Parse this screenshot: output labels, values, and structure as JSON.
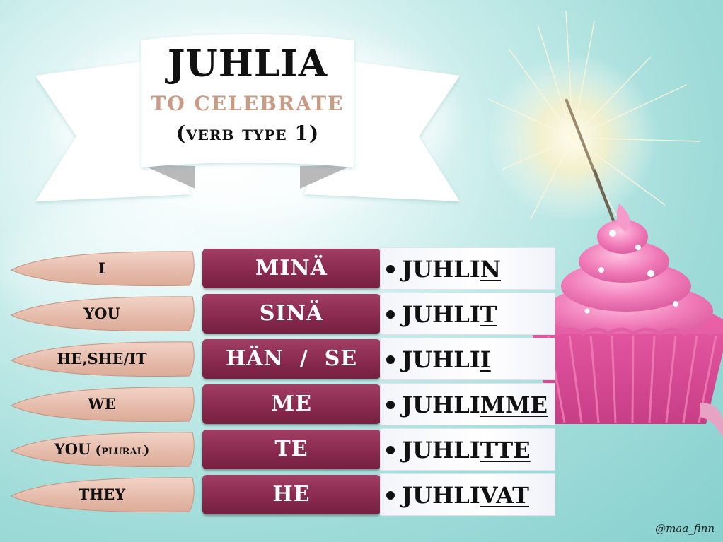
{
  "title": {
    "word": "JUHLIA",
    "meaning": "TO CELEBRATE",
    "type": "(verb type 1)"
  },
  "rows": [
    {
      "english": "I",
      "english_note": "",
      "pronoun": "MINÄ",
      "stem": "JUHLI",
      "ending": "N"
    },
    {
      "english": "YOU",
      "english_note": "",
      "pronoun": "SINÄ",
      "stem": "JUHLI",
      "ending": "T"
    },
    {
      "english": "HE,SHE/IT",
      "english_note": "",
      "pronoun": "HÄN  /  SE",
      "stem": "JUHLI",
      "ending": "I"
    },
    {
      "english": "WE",
      "english_note": "",
      "pronoun": "ME",
      "stem": "JUHLI",
      "ending": "MME"
    },
    {
      "english": "YOU",
      "english_note": "(plural)",
      "pronoun": "TE",
      "stem": "JUHLI",
      "ending": "TTE"
    },
    {
      "english": "THEY",
      "english_note": "",
      "pronoun": "HE",
      "stem": "JUHLI",
      "ending": "VAT"
    }
  ],
  "credit": "@maa_finn",
  "colors": {
    "background": "#9edbd8",
    "pronoun_box": "#8a2a4f",
    "english_leaf": "#eac3b3",
    "meaning_text": "#c99a84",
    "frosting": "#f07ab8"
  },
  "icons": {
    "ribbon": "banner-ribbon",
    "cupcake": "cupcake-with-sparkler"
  }
}
